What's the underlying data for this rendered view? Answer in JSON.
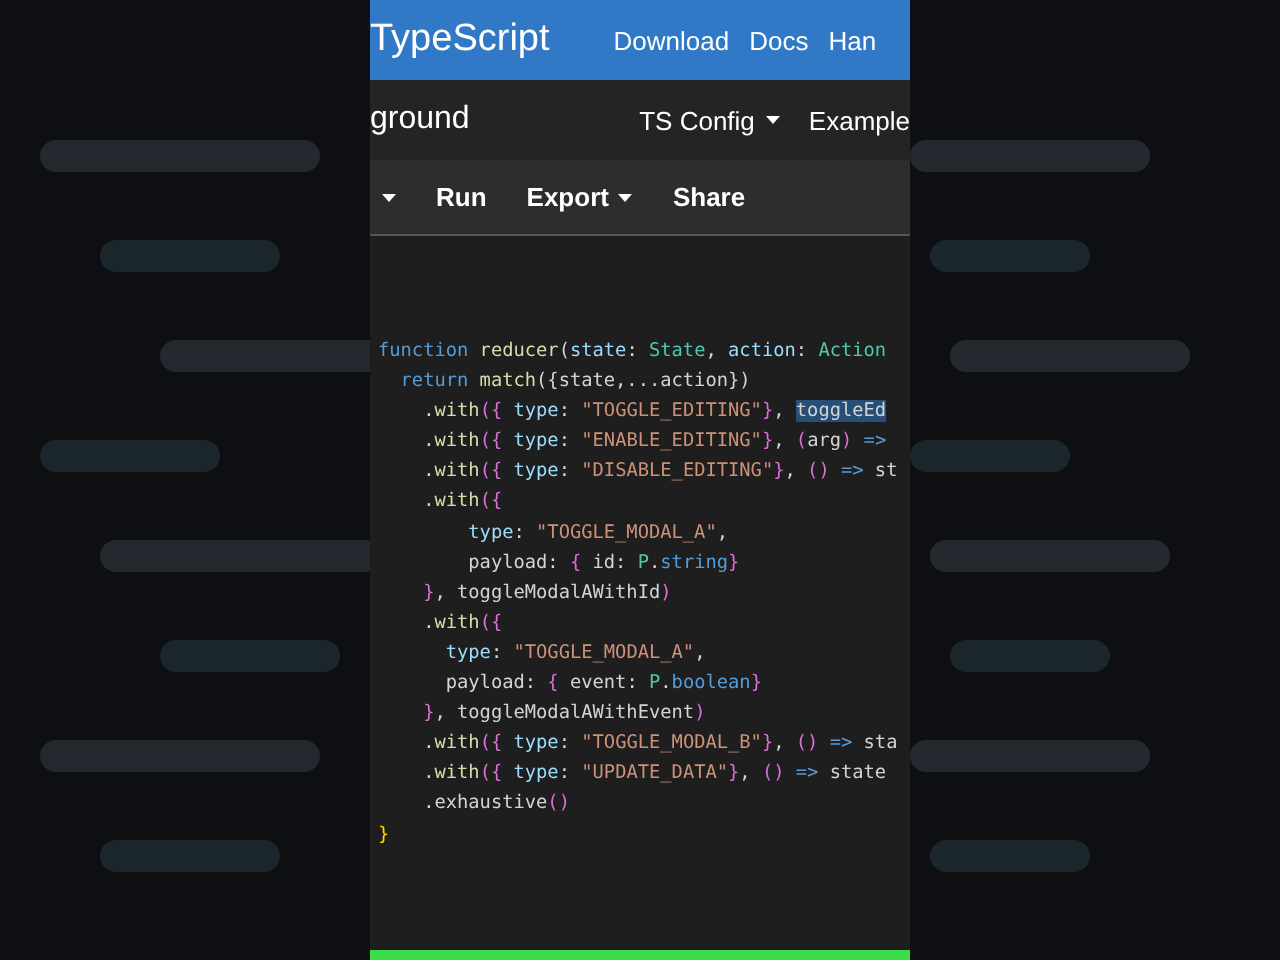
{
  "header": {
    "logo": "TypeScript",
    "links": [
      "Download",
      "Docs",
      "Han"
    ]
  },
  "subheader": {
    "title": "ground",
    "menus": [
      {
        "label": "TS Config",
        "caret": true
      },
      {
        "label": "Example",
        "caret": false
      }
    ]
  },
  "toolbar": [
    {
      "caret": true
    },
    {
      "label": "Run",
      "caret": false
    },
    {
      "label": "Export",
      "caret": true
    },
    {
      "label": "Share",
      "caret": false
    }
  ],
  "code": [
    [
      {
        "kind": "kw",
        "t": "function"
      },
      {
        "kind": "fn",
        "t": " reducer"
      },
      {
        "kind": "p",
        "t": "("
      },
      {
        "kind": "var",
        "t": "state"
      },
      {
        "kind": "p",
        "t": ": "
      },
      {
        "kind": "type",
        "t": "State"
      },
      {
        "kind": "p",
        "t": ", "
      },
      {
        "kind": "var",
        "t": "action"
      },
      {
        "kind": "p",
        "t": ": "
      },
      {
        "kind": "type",
        "t": "Action"
      }
    ],
    [
      {
        "kind": "kw",
        "t": "  return"
      },
      {
        "kind": "fn",
        "t": " match"
      },
      {
        "kind": "p",
        "t": "({state,...action})"
      }
    ],
    [
      {
        "kind": "p",
        "t": "    ."
      },
      {
        "kind": "fn",
        "t": "with"
      },
      {
        "kind": "br",
        "t": "({"
      },
      {
        "kind": "var",
        "t": " type"
      },
      {
        "kind": "p",
        "t": ": "
      },
      {
        "kind": "str",
        "t": "\"TOGGLE_EDITING\""
      },
      {
        "kind": "br",
        "t": "}"
      },
      {
        "kind": "p",
        "t": ", "
      },
      {
        "kind": "sel",
        "t": "toggleEd"
      }
    ],
    [
      {
        "kind": "p",
        "t": "    ."
      },
      {
        "kind": "fn",
        "t": "with"
      },
      {
        "kind": "br",
        "t": "({"
      },
      {
        "kind": "var",
        "t": " type"
      },
      {
        "kind": "p",
        "t": ": "
      },
      {
        "kind": "str",
        "t": "\"ENABLE_EDITING\""
      },
      {
        "kind": "br",
        "t": "}"
      },
      {
        "kind": "p",
        "t": ", "
      },
      {
        "kind": "br",
        "t": "("
      },
      {
        "kind": "p",
        "t": "arg"
      },
      {
        "kind": "br",
        "t": ")"
      },
      {
        "kind": "kw",
        "t": " =>"
      }
    ],
    [
      {
        "kind": "p",
        "t": "    ."
      },
      {
        "kind": "fn",
        "t": "with"
      },
      {
        "kind": "br",
        "t": "({"
      },
      {
        "kind": "var",
        "t": " type"
      },
      {
        "kind": "p",
        "t": ": "
      },
      {
        "kind": "str",
        "t": "\"DISABLE_EDITING\""
      },
      {
        "kind": "br",
        "t": "}"
      },
      {
        "kind": "p",
        "t": ", "
      },
      {
        "kind": "br",
        "t": "()"
      },
      {
        "kind": "kw",
        "t": " =>"
      },
      {
        "kind": "p",
        "t": " st"
      }
    ],
    [
      {
        "kind": "p",
        "t": "    ."
      },
      {
        "kind": "fn",
        "t": "with"
      },
      {
        "kind": "br",
        "t": "({"
      }
    ],
    [
      {
        "kind": "var",
        "t": "        type"
      },
      {
        "kind": "p",
        "t": ": "
      },
      {
        "kind": "str",
        "t": "\"TOGGLE_MODAL_A\""
      },
      {
        "kind": "p",
        "t": ","
      }
    ],
    [
      {
        "kind": "p",
        "t": "        payload: "
      },
      {
        "kind": "br",
        "t": "{"
      },
      {
        "kind": "p",
        "t": " id: "
      },
      {
        "kind": "type",
        "t": "P"
      },
      {
        "kind": "p",
        "t": "."
      },
      {
        "kind": "kw",
        "t": "string"
      },
      {
        "kind": "br",
        "t": "}"
      }
    ],
    [
      {
        "kind": "br",
        "t": "    }"
      },
      {
        "kind": "p",
        "t": ", toggleModalAWithId"
      },
      {
        "kind": "br",
        "t": ")"
      }
    ],
    [
      {
        "kind": "p",
        "t": "    ."
      },
      {
        "kind": "fn",
        "t": "with"
      },
      {
        "kind": "br",
        "t": "({"
      }
    ],
    [
      {
        "kind": "var",
        "t": "      type"
      },
      {
        "kind": "p",
        "t": ": "
      },
      {
        "kind": "str",
        "t": "\"TOGGLE_MODAL_A\""
      },
      {
        "kind": "p",
        "t": ","
      }
    ],
    [
      {
        "kind": "p",
        "t": "      payload: "
      },
      {
        "kind": "br",
        "t": "{"
      },
      {
        "kind": "p",
        "t": " event: "
      },
      {
        "kind": "type",
        "t": "P"
      },
      {
        "kind": "p",
        "t": "."
      },
      {
        "kind": "kw",
        "t": "boolean"
      },
      {
        "kind": "br",
        "t": "}"
      }
    ],
    [
      {
        "kind": "br",
        "t": "    }"
      },
      {
        "kind": "p",
        "t": ", toggleModalAWithEvent"
      },
      {
        "kind": "br",
        "t": ")"
      }
    ],
    [
      {
        "kind": "p",
        "t": "    ."
      },
      {
        "kind": "fn",
        "t": "with"
      },
      {
        "kind": "br",
        "t": "({"
      },
      {
        "kind": "var",
        "t": " type"
      },
      {
        "kind": "p",
        "t": ": "
      },
      {
        "kind": "str",
        "t": "\"TOGGLE_MODAL_B\""
      },
      {
        "kind": "br",
        "t": "}"
      },
      {
        "kind": "p",
        "t": ", "
      },
      {
        "kind": "br",
        "t": "()"
      },
      {
        "kind": "kw",
        "t": " =>"
      },
      {
        "kind": "p",
        "t": " sta"
      }
    ],
    [
      {
        "kind": "p",
        "t": "    ."
      },
      {
        "kind": "fn",
        "t": "with"
      },
      {
        "kind": "br",
        "t": "({"
      },
      {
        "kind": "var",
        "t": " type"
      },
      {
        "kind": "p",
        "t": ": "
      },
      {
        "kind": "str",
        "t": "\"UPDATE_DATA\""
      },
      {
        "kind": "br",
        "t": "}"
      },
      {
        "kind": "p",
        "t": ", "
      },
      {
        "kind": "br",
        "t": "()"
      },
      {
        "kind": "kw",
        "t": " =>"
      },
      {
        "kind": "p",
        "t": " state"
      }
    ],
    [
      {
        "kind": "p",
        "t": "    .exhaustive"
      },
      {
        "kind": "br",
        "t": "()"
      }
    ],
    [
      {
        "kind": "gold",
        "t": "}"
      }
    ]
  ],
  "progress": {
    "level": 1
  }
}
